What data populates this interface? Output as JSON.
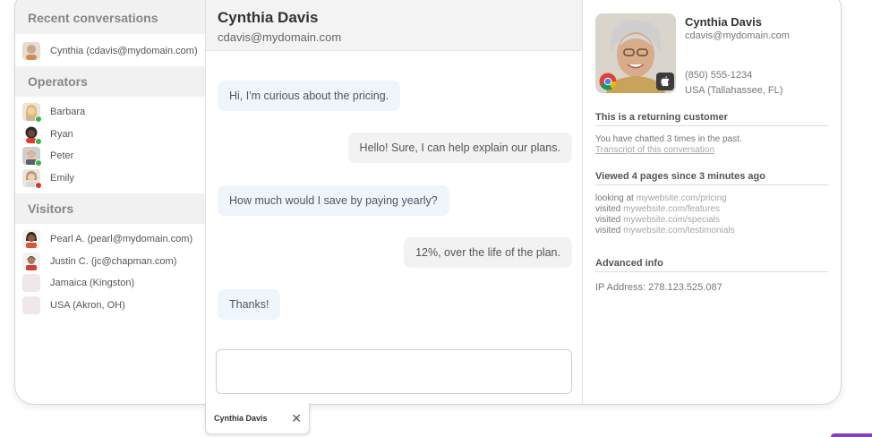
{
  "sidebar": {
    "recent_title": "Recent conversations",
    "recent": [
      {
        "label": "Cynthia (cdavis@mydomain.com)"
      }
    ],
    "operators_title": "Operators",
    "operators": [
      {
        "label": "Barbara",
        "status_color": "#3cb34a"
      },
      {
        "label": "Ryan",
        "status_color": "#3cb34a"
      },
      {
        "label": "Peter",
        "status_color": "#3cb34a"
      },
      {
        "label": "Emily",
        "status_color": "#e03131"
      }
    ],
    "visitors_title": "Visitors",
    "visitors": [
      {
        "label": "Pearl A. (pearl@mydomain.com)"
      },
      {
        "label": "Justin C. (jc@chapman.com)"
      },
      {
        "label": "Jamaica (Kingston)"
      },
      {
        "label": "USA (Akron, OH)"
      }
    ]
  },
  "chat": {
    "name": "Cynthia Davis",
    "email": "cdavis@mydomain.com",
    "messages": [
      {
        "from": "visitor",
        "text": "Hi, I'm curious about the pricing."
      },
      {
        "from": "operator",
        "text": "Hello! Sure, I can help explain our plans."
      },
      {
        "from": "visitor",
        "text": "How much would I save by paying yearly?"
      },
      {
        "from": "operator",
        "text": "12%, over the life of the plan."
      },
      {
        "from": "visitor",
        "text": "Thanks!"
      }
    ],
    "input_value": ""
  },
  "profile": {
    "name": "Cynthia Davis",
    "email": "cdavis@mydomain.com",
    "phone": "(850) 555-1234",
    "location": "USA (Tallahassee, FL)",
    "browser_icon": "chrome-icon",
    "os_icon": "apple-icon",
    "returning_title": "This is a returning customer",
    "returning_text": "You have chatted 3 times in the past.",
    "transcript_link": "Transcript of this conversation",
    "pages_title": "Viewed 4 pages since 3 minutes ago",
    "pages": [
      {
        "action": "looking at",
        "url": "mywebsite.com/pricing"
      },
      {
        "action": "visited",
        "url": "mywebsite.com/features"
      },
      {
        "action": "visited",
        "url": "mywebsite.com/specials"
      },
      {
        "action": "visited",
        "url": "mywebsite.com/testimonials"
      }
    ],
    "advanced_title": "Advanced info",
    "ip_text": "IP Address: 278.123.525.087"
  },
  "bottom_tab": {
    "label": "Cynthia Davis",
    "close_icon": "close-icon"
  },
  "colors": {
    "online": "#3cb34a",
    "busy": "#e03131",
    "visitor_bubble": "#eef5fd",
    "operator_bubble": "#f2f2f2",
    "accent": "#8a3dbf"
  }
}
